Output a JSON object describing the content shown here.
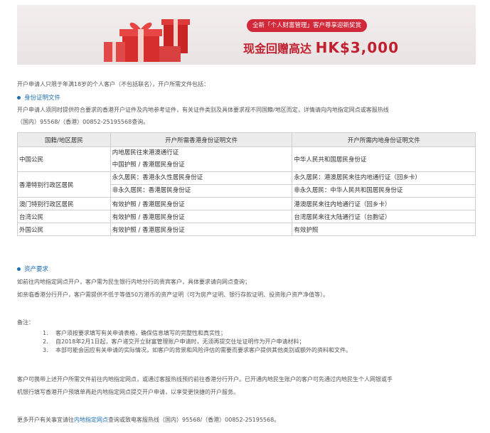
{
  "banner": {
    "pill": "全新「个人财富管理」客户尊享迎新奖赏",
    "amount_prefix": "现金回赠高达",
    "amount": "HK$3,000"
  },
  "intro": "开户申请人只限于年满18岁的个人客户（不包括联名），开户所需文件包括：",
  "identity": {
    "heading": "身份证明文件",
    "desc_line1": "开户申请人须同时提供符合要求的香港开户证件及内地参考证件，有关证件类别及具体要求视不同国籍/地区而定，详情请向内地指定网点或客服热线",
    "desc_line2": "（国内）95568/（香港）00852-25195568查询。",
    "table": {
      "headers": [
        "国籍/地区居民",
        "开户所需香港身份证明文件",
        "开户所需内地身份证明文件"
      ],
      "rows": [
        {
          "region": "中国公民",
          "hk": [
            "内地居民往来港澳通行证",
            "中国护照 / 香港居民身份证"
          ],
          "mainland": [
            "中华人民共和国居民身份证"
          ]
        },
        {
          "region": "香港特别行政区居民",
          "hk": [
            "永久居民：香港永久性居民身份证",
            "非永久居民：香港居民身份证"
          ],
          "mainland": [
            "永久居民：港澳居民来往内地通行证（回乡卡）",
            "非永久居民：中华人民共和国居民身份证"
          ]
        },
        {
          "region": "澳门特别行政区居民",
          "hk": [
            "有效护照 / 香港居民身份证"
          ],
          "mainland": [
            "港澳居民来往内地通行证（回乡卡）"
          ]
        },
        {
          "region": "台湾公民",
          "hk": [
            "有效护照 / 香港居民身份证"
          ],
          "mainland": [
            "台湾居民来往大陆通行证（台胞证）"
          ]
        },
        {
          "region": "外国公民",
          "hk": [
            "有效护照 / 香港居民身份证"
          ],
          "mainland": [
            "有效护照"
          ]
        }
      ]
    }
  },
  "assets": {
    "heading": "资产要求",
    "line1": "如前往内地指定网点开户，客户需为民生银行内地分行的贵宾客户，具体要求请向网点查询；",
    "line2": "如亲临香港分行开户，客户需提供不低于等值50万港币的资产证明（可为房产证明、银行存款证明、投资账户资产净值等）。"
  },
  "notes": {
    "title": "备注：",
    "items": [
      {
        "num": "1.",
        "text": "客户须按要求填写有关申请表格，确保信息填写的完整性和真实性；"
      },
      {
        "num": "2.",
        "text": "自2018年2月1日起，客户递交开立财富管理账户申请时，无须再提交住址证明作为开户申请材料；"
      },
      {
        "num": "3.",
        "text": "本部可能会因应有关申请的实际情况，如客户的背景和风险评估的需要而要求客户提供其他类别或额外的资料和文件。"
      }
    ]
  },
  "closing": {
    "line1": "客户可携带上述开户所需文件前往内地指定网点，或通过客服热线预约前往香港分行开户。已开通内地民生账户的客户可先通过内地民生个人网银或手",
    "line2": "机银行填写香港开户预填单再赴内地指定网点提交开户申请，以享受更快捷的开户服务。"
  },
  "footer": {
    "prefix": "更多开户有关事宜请往",
    "link": "内地指定网点",
    "suffix": "查询或致电客服热线（国内）95568/（香港）00852-25195568。"
  }
}
